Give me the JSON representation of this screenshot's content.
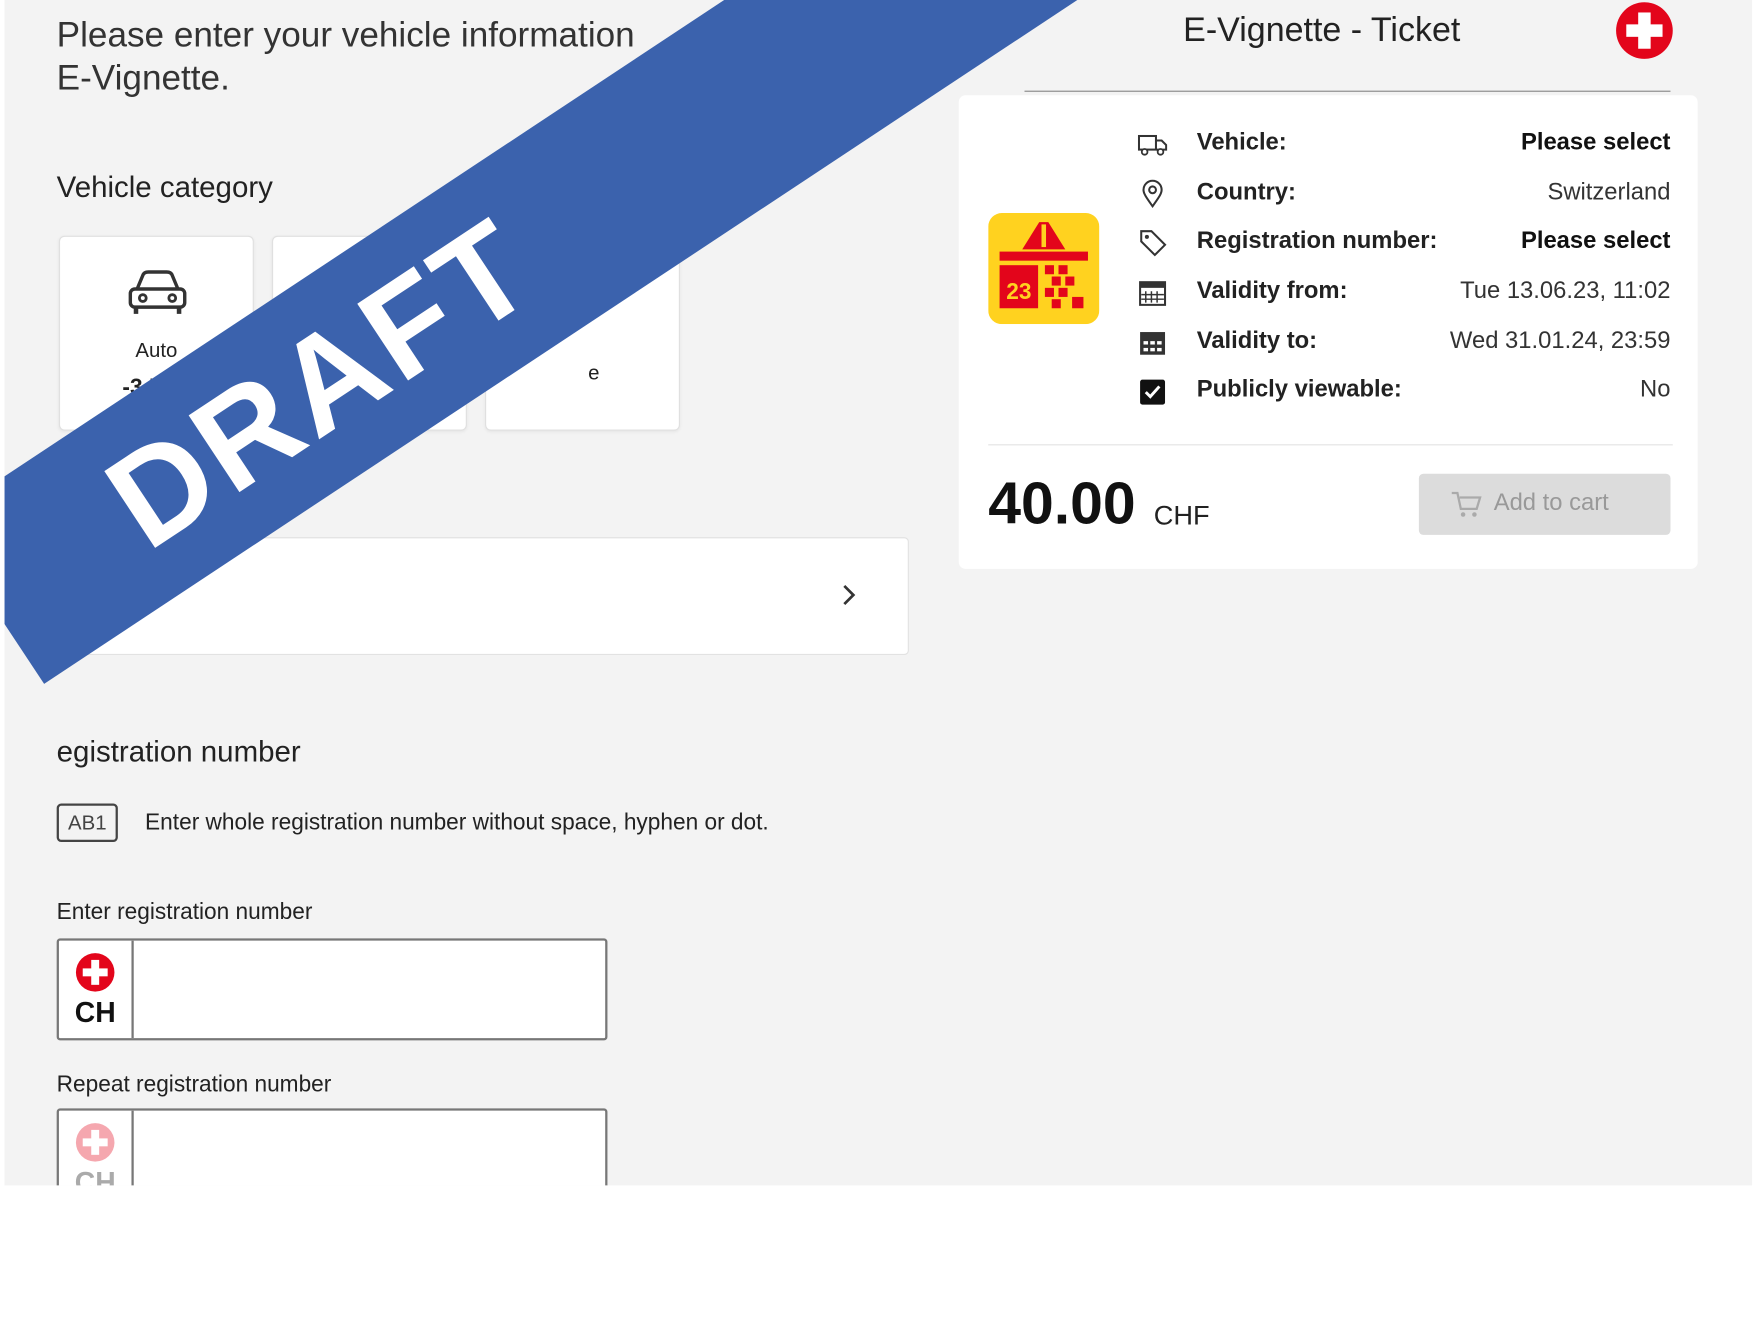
{
  "intro": {
    "line1": "Please enter your vehicle information",
    "line2": "E-Vignette."
  },
  "vehicle_category": {
    "heading": "Vehicle category",
    "cards": [
      {
        "label": "Auto",
        "sub": "-3.5",
        "icon": "car-icon"
      },
      {
        "label": "",
        "icon": ""
      },
      {
        "label": "e",
        "icon": ""
      }
    ]
  },
  "registration": {
    "heading": "Registration number",
    "heading_visible": "egistration number",
    "hint_icon_text": "AB1",
    "hint": "Enter whole registration number without space, hyphen or dot.",
    "enter_label": "Enter registration number",
    "repeat_label": "Repeat registration number",
    "country_code": "CH",
    "enter_value": "",
    "repeat_value": ""
  },
  "ticket": {
    "title": "E-Vignette - Ticket",
    "vignette_year": "23",
    "details": [
      {
        "icon": "vehicle-icon",
        "label": "Vehicle:",
        "value": "Please select",
        "bold": true
      },
      {
        "icon": "location-pin-icon",
        "label": "Country:",
        "value": "Switzerland",
        "bold": false
      },
      {
        "icon": "tag-icon",
        "label": "Registration number:",
        "value": "Please select",
        "bold": true
      },
      {
        "icon": "calendar-icon",
        "label": "Validity from:",
        "value": "Tue 13.06.23, 11:02",
        "bold": false
      },
      {
        "icon": "calendar-filled-icon",
        "label": "Validity to:",
        "value": "Wed 31.01.24, 23:59",
        "bold": false
      },
      {
        "icon": "checkbox-checked-icon",
        "label": "Publicly viewable:",
        "value": "No",
        "bold": false
      }
    ],
    "price": "40.00",
    "currency": "CHF",
    "add_to_cart": "Add to cart"
  },
  "banner": {
    "text": "DRAFT"
  },
  "colors": {
    "banner": "#3b62ad",
    "swiss_red": "#e3051b",
    "vignette_yellow": "#ffd21f"
  }
}
